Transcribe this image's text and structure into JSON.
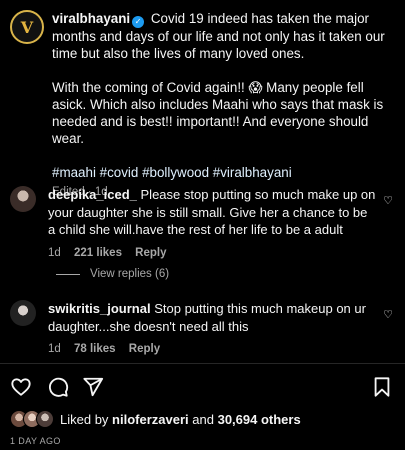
{
  "post": {
    "username": "viralbhayani",
    "caption_line1": "Covid 19 indeed has taken the major months and days of our life and not only has it taken our time but also the lives of many loved ones.",
    "caption_line2": "With the coming of Covid again!! 😱  Many people fell asick. Which also includes Maahi who says that mask is needed and is best!! important!! And everyone should wear.",
    "hashtags": "#maahi #covid #bollywood #viralbhayani",
    "edited": "Edited · 1d"
  },
  "comments": [
    {
      "username": "deepika_iced_",
      "text": "Please stop putting so much make up on your daughter she is still small. Give her a chance to be a child she will.have the rest of her life to be a adult",
      "age": "1d",
      "likes": "221 likes",
      "reply": "Reply",
      "view_replies": "View replies (6)"
    },
    {
      "username": "swikritis_journal",
      "text": "Stop putting this much makeup on ur daughter...she doesn't need all this",
      "age": "1d",
      "likes": "78 likes",
      "reply": "Reply"
    }
  ],
  "likes_bar": {
    "prefix": "Liked by",
    "first_liker": "niloferzaveri",
    "conj": "and",
    "others": "30,694 others"
  },
  "timestamp": "1 DAY AGO",
  "icons": {
    "like": "heart-icon",
    "comment": "comment-icon",
    "share": "share-icon",
    "save": "bookmark-icon",
    "verified": "verified-badge-icon"
  }
}
